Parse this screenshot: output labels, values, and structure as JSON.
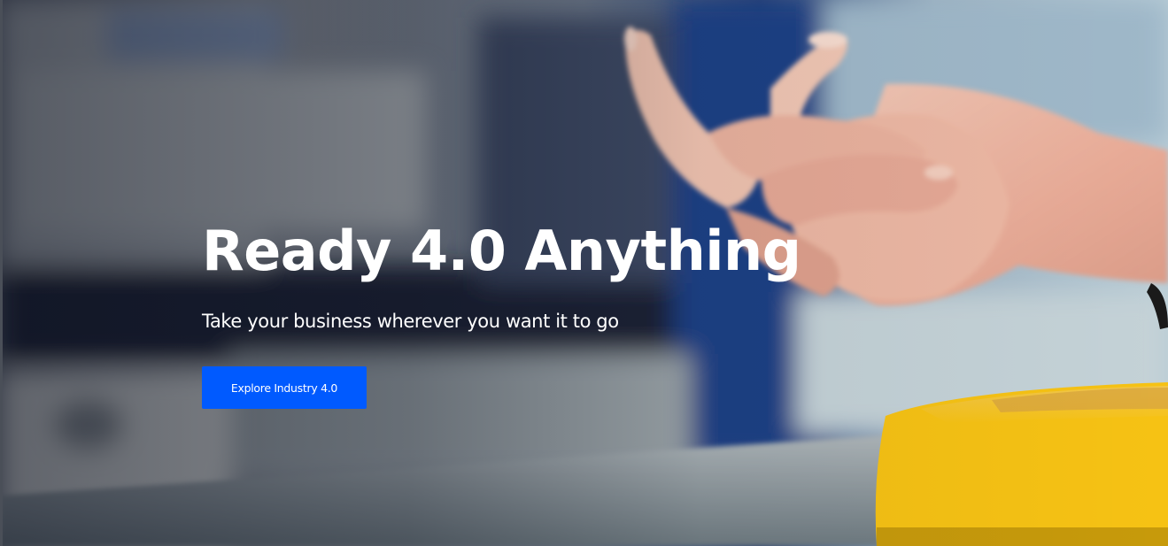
{
  "hero": {
    "headline": "Ready 4.0 Anything",
    "subheadline": "Take your business wherever you want it to go",
    "cta_label": "Explore Industry 4.0"
  },
  "colors": {
    "cta_background": "#005aff",
    "text": "#ffffff",
    "button_yellow": "#f6c214"
  },
  "background_photo": {
    "icon": "hand-pressing-yellow-button-photo"
  }
}
